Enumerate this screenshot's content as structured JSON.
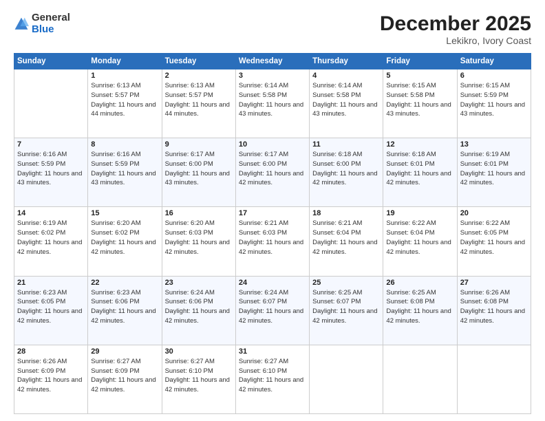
{
  "logo": {
    "general": "General",
    "blue": "Blue"
  },
  "header": {
    "title": "December 2025",
    "subtitle": "Lekikro, Ivory Coast"
  },
  "weekdays": [
    "Sunday",
    "Monday",
    "Tuesday",
    "Wednesday",
    "Thursday",
    "Friday",
    "Saturday"
  ],
  "weeks": [
    [
      {
        "day": "",
        "sunrise": "",
        "sunset": "",
        "daylight": ""
      },
      {
        "day": "1",
        "sunrise": "Sunrise: 6:13 AM",
        "sunset": "Sunset: 5:57 PM",
        "daylight": "Daylight: 11 hours and 44 minutes."
      },
      {
        "day": "2",
        "sunrise": "Sunrise: 6:13 AM",
        "sunset": "Sunset: 5:57 PM",
        "daylight": "Daylight: 11 hours and 44 minutes."
      },
      {
        "day": "3",
        "sunrise": "Sunrise: 6:14 AM",
        "sunset": "Sunset: 5:58 PM",
        "daylight": "Daylight: 11 hours and 43 minutes."
      },
      {
        "day": "4",
        "sunrise": "Sunrise: 6:14 AM",
        "sunset": "Sunset: 5:58 PM",
        "daylight": "Daylight: 11 hours and 43 minutes."
      },
      {
        "day": "5",
        "sunrise": "Sunrise: 6:15 AM",
        "sunset": "Sunset: 5:58 PM",
        "daylight": "Daylight: 11 hours and 43 minutes."
      },
      {
        "day": "6",
        "sunrise": "Sunrise: 6:15 AM",
        "sunset": "Sunset: 5:59 PM",
        "daylight": "Daylight: 11 hours and 43 minutes."
      }
    ],
    [
      {
        "day": "7",
        "sunrise": "Sunrise: 6:16 AM",
        "sunset": "Sunset: 5:59 PM",
        "daylight": "Daylight: 11 hours and 43 minutes."
      },
      {
        "day": "8",
        "sunrise": "Sunrise: 6:16 AM",
        "sunset": "Sunset: 5:59 PM",
        "daylight": "Daylight: 11 hours and 43 minutes."
      },
      {
        "day": "9",
        "sunrise": "Sunrise: 6:17 AM",
        "sunset": "Sunset: 6:00 PM",
        "daylight": "Daylight: 11 hours and 43 minutes."
      },
      {
        "day": "10",
        "sunrise": "Sunrise: 6:17 AM",
        "sunset": "Sunset: 6:00 PM",
        "daylight": "Daylight: 11 hours and 42 minutes."
      },
      {
        "day": "11",
        "sunrise": "Sunrise: 6:18 AM",
        "sunset": "Sunset: 6:00 PM",
        "daylight": "Daylight: 11 hours and 42 minutes."
      },
      {
        "day": "12",
        "sunrise": "Sunrise: 6:18 AM",
        "sunset": "Sunset: 6:01 PM",
        "daylight": "Daylight: 11 hours and 42 minutes."
      },
      {
        "day": "13",
        "sunrise": "Sunrise: 6:19 AM",
        "sunset": "Sunset: 6:01 PM",
        "daylight": "Daylight: 11 hours and 42 minutes."
      }
    ],
    [
      {
        "day": "14",
        "sunrise": "Sunrise: 6:19 AM",
        "sunset": "Sunset: 6:02 PM",
        "daylight": "Daylight: 11 hours and 42 minutes."
      },
      {
        "day": "15",
        "sunrise": "Sunrise: 6:20 AM",
        "sunset": "Sunset: 6:02 PM",
        "daylight": "Daylight: 11 hours and 42 minutes."
      },
      {
        "day": "16",
        "sunrise": "Sunrise: 6:20 AM",
        "sunset": "Sunset: 6:03 PM",
        "daylight": "Daylight: 11 hours and 42 minutes."
      },
      {
        "day": "17",
        "sunrise": "Sunrise: 6:21 AM",
        "sunset": "Sunset: 6:03 PM",
        "daylight": "Daylight: 11 hours and 42 minutes."
      },
      {
        "day": "18",
        "sunrise": "Sunrise: 6:21 AM",
        "sunset": "Sunset: 6:04 PM",
        "daylight": "Daylight: 11 hours and 42 minutes."
      },
      {
        "day": "19",
        "sunrise": "Sunrise: 6:22 AM",
        "sunset": "Sunset: 6:04 PM",
        "daylight": "Daylight: 11 hours and 42 minutes."
      },
      {
        "day": "20",
        "sunrise": "Sunrise: 6:22 AM",
        "sunset": "Sunset: 6:05 PM",
        "daylight": "Daylight: 11 hours and 42 minutes."
      }
    ],
    [
      {
        "day": "21",
        "sunrise": "Sunrise: 6:23 AM",
        "sunset": "Sunset: 6:05 PM",
        "daylight": "Daylight: 11 hours and 42 minutes."
      },
      {
        "day": "22",
        "sunrise": "Sunrise: 6:23 AM",
        "sunset": "Sunset: 6:06 PM",
        "daylight": "Daylight: 11 hours and 42 minutes."
      },
      {
        "day": "23",
        "sunrise": "Sunrise: 6:24 AM",
        "sunset": "Sunset: 6:06 PM",
        "daylight": "Daylight: 11 hours and 42 minutes."
      },
      {
        "day": "24",
        "sunrise": "Sunrise: 6:24 AM",
        "sunset": "Sunset: 6:07 PM",
        "daylight": "Daylight: 11 hours and 42 minutes."
      },
      {
        "day": "25",
        "sunrise": "Sunrise: 6:25 AM",
        "sunset": "Sunset: 6:07 PM",
        "daylight": "Daylight: 11 hours and 42 minutes."
      },
      {
        "day": "26",
        "sunrise": "Sunrise: 6:25 AM",
        "sunset": "Sunset: 6:08 PM",
        "daylight": "Daylight: 11 hours and 42 minutes."
      },
      {
        "day": "27",
        "sunrise": "Sunrise: 6:26 AM",
        "sunset": "Sunset: 6:08 PM",
        "daylight": "Daylight: 11 hours and 42 minutes."
      }
    ],
    [
      {
        "day": "28",
        "sunrise": "Sunrise: 6:26 AM",
        "sunset": "Sunset: 6:09 PM",
        "daylight": "Daylight: 11 hours and 42 minutes."
      },
      {
        "day": "29",
        "sunrise": "Sunrise: 6:27 AM",
        "sunset": "Sunset: 6:09 PM",
        "daylight": "Daylight: 11 hours and 42 minutes."
      },
      {
        "day": "30",
        "sunrise": "Sunrise: 6:27 AM",
        "sunset": "Sunset: 6:10 PM",
        "daylight": "Daylight: 11 hours and 42 minutes."
      },
      {
        "day": "31",
        "sunrise": "Sunrise: 6:27 AM",
        "sunset": "Sunset: 6:10 PM",
        "daylight": "Daylight: 11 hours and 42 minutes."
      },
      {
        "day": "",
        "sunrise": "",
        "sunset": "",
        "daylight": ""
      },
      {
        "day": "",
        "sunrise": "",
        "sunset": "",
        "daylight": ""
      },
      {
        "day": "",
        "sunrise": "",
        "sunset": "",
        "daylight": ""
      }
    ]
  ]
}
